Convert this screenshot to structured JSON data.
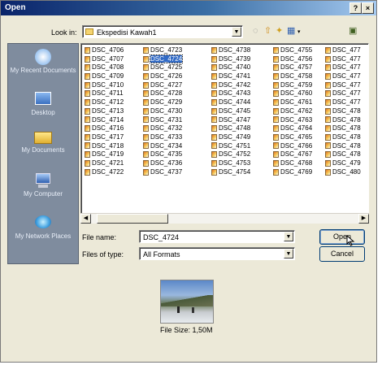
{
  "window": {
    "title": "Open",
    "help_glyph": "?",
    "close_glyph": "×"
  },
  "toolbar": {
    "look_in_label": "Look in:",
    "look_in_value": "Ekspedisi Kawah1",
    "icons": [
      "folder-icon",
      "back-icon",
      "up-folder-icon",
      "new-folder-icon",
      "views-icon",
      "desktop-icon"
    ]
  },
  "places": [
    {
      "id": "recent",
      "label": "My Recent Documents",
      "icon": "recent-documents-icon"
    },
    {
      "id": "desktop",
      "label": "Desktop",
      "icon": "desktop-icon"
    },
    {
      "id": "documents",
      "label": "My Documents",
      "icon": "documents-folder-icon"
    },
    {
      "id": "computer",
      "label": "My Computer",
      "icon": "computer-icon"
    },
    {
      "id": "network",
      "label": "My Network Places",
      "icon": "network-icon"
    }
  ],
  "files": {
    "selected": "DSC_4724",
    "columns": [
      [
        "DSC_4706",
        "DSC_4707",
        "DSC_4708",
        "DSC_4709",
        "DSC_4710",
        "DSC_4711",
        "DSC_4712",
        "DSC_4713",
        "DSC_4714",
        "DSC_4716",
        "DSC_4717",
        "DSC_4718",
        "DSC_4719",
        "DSC_4721",
        "DSC_4722"
      ],
      [
        "DSC_4723",
        "DSC_4724",
        "DSC_4725",
        "DSC_4726",
        "DSC_4727",
        "DSC_4728",
        "DSC_4729",
        "DSC_4730",
        "DSC_4731",
        "DSC_4732",
        "DSC_4733",
        "DSC_4734",
        "DSC_4735",
        "DSC_4736",
        "DSC_4737"
      ],
      [
        "DSC_4738",
        "DSC_4739",
        "DSC_4740",
        "DSC_4741",
        "DSC_4742",
        "DSC_4743",
        "DSC_4744",
        "DSC_4745",
        "DSC_4747",
        "DSC_4748",
        "DSC_4749",
        "DSC_4751",
        "DSC_4752",
        "DSC_4753",
        "DSC_4754"
      ],
      [
        "DSC_4755",
        "DSC_4756",
        "DSC_4757",
        "DSC_4758",
        "DSC_4759",
        "DSC_4760",
        "DSC_4761",
        "DSC_4762",
        "DSC_4763",
        "DSC_4764",
        "DSC_4765",
        "DSC_4766",
        "DSC_4767",
        "DSC_4768",
        "DSC_4769"
      ],
      [
        "DSC_477",
        "DSC_477",
        "DSC_477",
        "DSC_477",
        "DSC_477",
        "DSC_477",
        "DSC_477",
        "DSC_478",
        "DSC_478",
        "DSC_478",
        "DSC_478",
        "DSC_478",
        "DSC_478",
        "DSC_479",
        "DSC_480"
      ]
    ]
  },
  "form": {
    "file_name_label": "File name:",
    "file_name_value": "DSC_4724",
    "file_type_label": "Files of type:",
    "file_type_value": "All Formats",
    "open_label": "Open",
    "cancel_label": "Cancel"
  },
  "preview": {
    "file_size": "File Size: 1,50M"
  }
}
